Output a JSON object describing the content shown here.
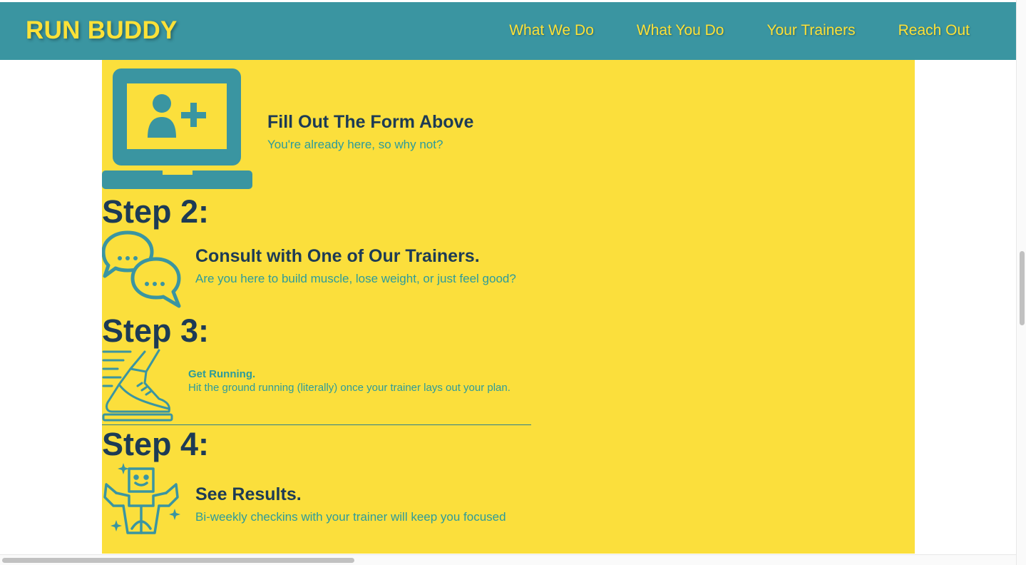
{
  "header": {
    "brand": "RUN BUDDY",
    "nav": [
      "What We Do",
      "What You Do",
      "Your Trainers",
      "Reach Out"
    ]
  },
  "steps": [
    {
      "heading": "Fill Out The Form Above",
      "text": "You're already here, so why not?",
      "icon": "laptop-add-user-icon"
    },
    {
      "title": "Step 2:",
      "heading": "Consult with One of Our Trainers.",
      "text": "Are you here to build muscle, lose weight, or just feel good?",
      "icon": "chat-bubbles-icon"
    },
    {
      "title": "Step 3:",
      "heading": "Get Running.",
      "text": "Hit the ground running (literally) once your trainer lays out your plan.",
      "icon": "running-shoe-icon"
    },
    {
      "title": "Step 4:",
      "heading": "See Results.",
      "text": "Bi-weekly checkins with your trainer will keep you focused",
      "icon": "strong-person-icon"
    }
  ],
  "colors": {
    "header_bg": "#3a95a1",
    "brand": "#fce138",
    "content_bg": "#fbdf3c",
    "heading": "#1d3b55",
    "text": "#2c9b9b"
  }
}
